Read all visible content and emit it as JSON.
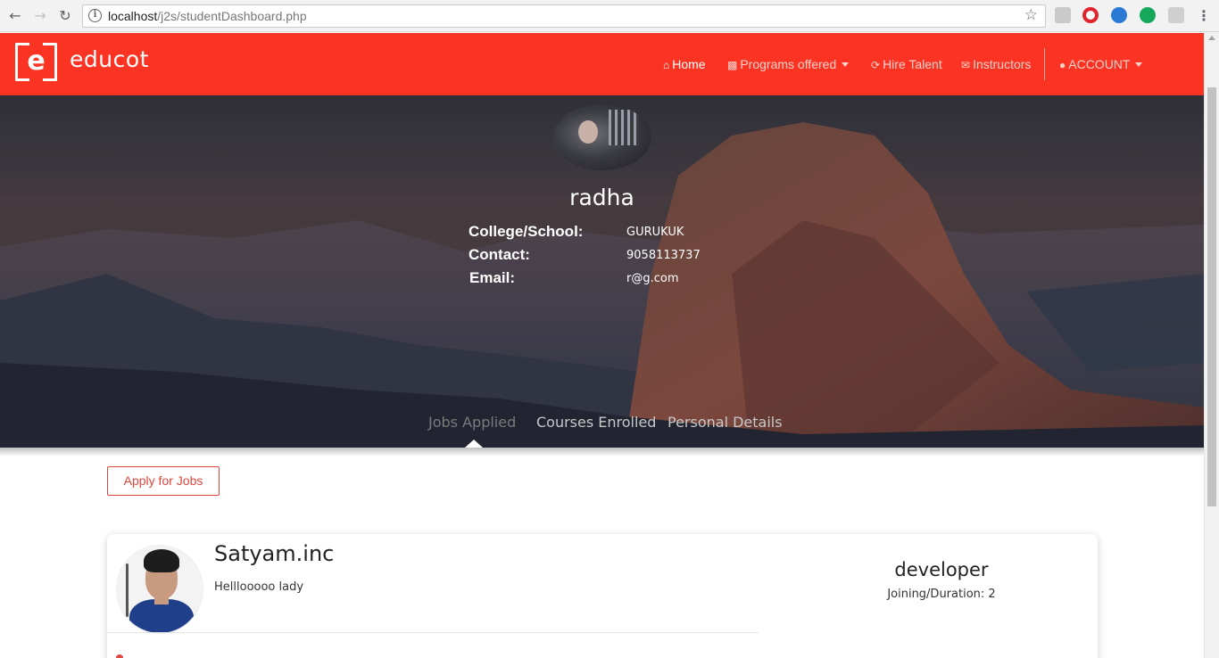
{
  "browser": {
    "url_host": "localhost",
    "url_path": "/j2s/studentDashboard.php"
  },
  "nav": {
    "brand": "educot",
    "logo_letter": "e",
    "home": "Home",
    "programs": "Programs offered",
    "hire": "Hire Talent",
    "instructors": "Instructors",
    "account": "ACCOUNT"
  },
  "profile": {
    "name": "radha",
    "college_label": "College/School:",
    "college_value": "GURUKUK",
    "contact_label": "Contact:",
    "contact_value": "9058113737",
    "email_label": "Email:",
    "email_value": "r@g.com"
  },
  "tabs": [
    "Jobs Applied",
    "Courses Enrolled",
    "Personal Details"
  ],
  "actions": {
    "apply_label": "Apply for Jobs"
  },
  "job": {
    "company": "Satyam.inc",
    "description": "Helllooooo lady",
    "role": "developer",
    "duration": "Joining/Duration: 2"
  },
  "colors": {
    "brand_red": "#fb3322",
    "button_red": "#e0463c"
  }
}
